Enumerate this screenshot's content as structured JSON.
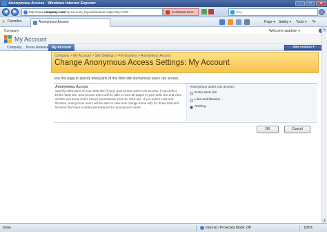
{
  "window": {
    "title": "Anonymous Access - Windows Internet Explorer",
    "controls": [
      "_",
      "□",
      "x"
    ]
  },
  "addressbar": {
    "url_prefix": "http://www.",
    "url_host": "company.com",
    "url_rest": "/my-account/_layouts/setanon.aspx?obj=%7B...",
    "cert_error": "Certificate Error",
    "search_placeholder": "Bing"
  },
  "commandbar": {
    "favorites": "Favorites",
    "tab_title": "Anonymous Access",
    "page": "Page ▾",
    "safety": "Safety ▾",
    "tools": "Tools ▾",
    "help": "?▾"
  },
  "sharepoint": {
    "breadcrumb": "Company",
    "welcome": "Welcome spadmin ▾",
    "help_icon": "?",
    "site_title": "My Account",
    "nav": [
      "Company",
      "Press Releases",
      "My Account"
    ],
    "site_actions": "Site Actions ▾",
    "crumbs": "Company > My Account > Site Settings > Permissions > Anonymous Access",
    "page_title": "Change Anonymous Access Settings: My Account",
    "description": "Use this page to specify what parts of this Web site anonymous users can access.",
    "section_title": "Anonymous Access",
    "section_desc": "Specify what parts of your Web site (if any) anonymous users can access. If you select Entire Web site, anonymous users will be able to view all pages in your Web site and view all lists and items which inherit permissions from the Web site. If you select Lists and libraries, anonymous users will be able to view and change items only for those lists and libraries that have enabled permissions for anonymous users.",
    "options_label": "Anonymous users can access:",
    "options": [
      {
        "label": "Entire Web site",
        "selected": false
      },
      {
        "label": "Lists and libraries",
        "selected": false
      },
      {
        "label": "Nothing",
        "selected": true
      }
    ],
    "ok": "OK",
    "cancel": "Cancel"
  },
  "statusbar": {
    "status": "Done",
    "zone": "Internet | Protected Mode: Off",
    "zoom": "100%"
  },
  "colors": {
    "title_gradient_top": "#fde28a",
    "title_gradient_bottom": "#f6c24c",
    "nav_selected": "#3d64a6",
    "cert_error_bg": "#f2c3c0"
  }
}
